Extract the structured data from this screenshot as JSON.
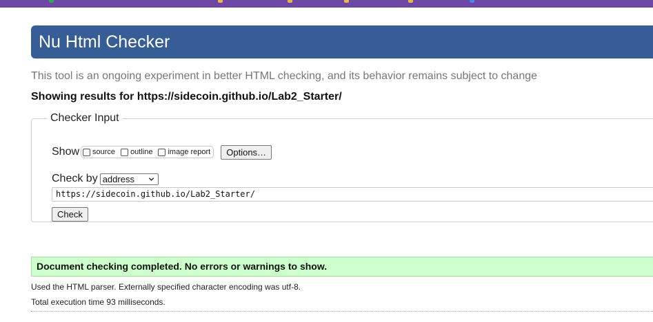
{
  "browser": {
    "bookmark_colors": [
      "#34a853",
      "#e8b84a",
      "#e8b84a",
      "#e8b84a",
      "#e8b84a",
      "#4a86e8"
    ]
  },
  "header": {
    "title": "Nu Html Checker"
  },
  "intro": "This tool is an ongoing experiment in better HTML checking, and its behavior remains subject to change",
  "results_for": "Showing results for https://sidecoin.github.io/Lab2_Starter/",
  "checker_input": {
    "legend": "Checker Input",
    "show_label": "Show",
    "options": [
      {
        "label": "source",
        "checked": false
      },
      {
        "label": "outline",
        "checked": false
      },
      {
        "label": "image report",
        "checked": false
      }
    ],
    "options_button": "Options…",
    "check_by_label": "Check by",
    "check_by_value": "address",
    "url_value": "https://sidecoin.github.io/Lab2_Starter/",
    "check_button": "Check"
  },
  "result": {
    "message": "Document checking completed. No errors or warnings to show.",
    "status_color": "#ccffcc"
  },
  "notes": {
    "parser": "Used the HTML parser. Externally specified character encoding was utf-8.",
    "time": "Total execution time 93 milliseconds."
  }
}
